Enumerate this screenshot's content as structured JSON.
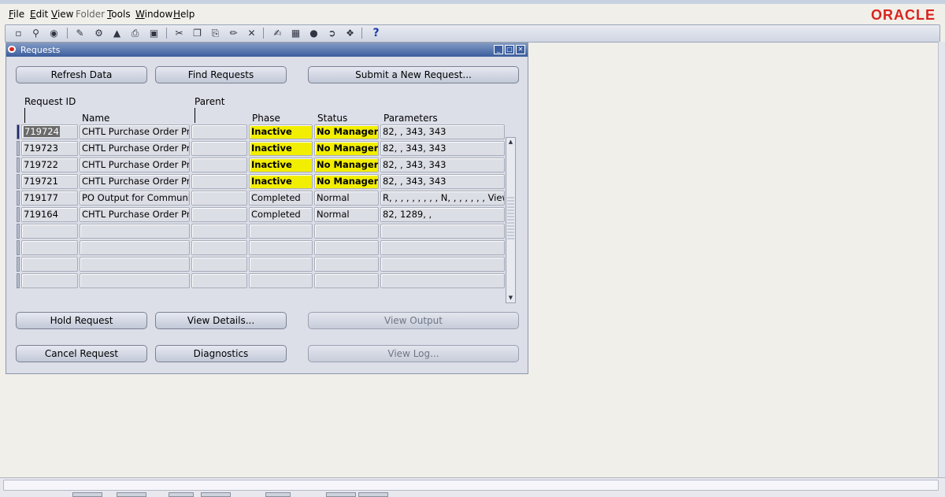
{
  "menu": {
    "items": [
      {
        "label": "File",
        "underline": "F",
        "rest": "ile",
        "disabled": false
      },
      {
        "label": "Edit",
        "underline": "E",
        "rest": "dit",
        "disabled": false
      },
      {
        "label": "View",
        "underline": "V",
        "rest": "iew",
        "disabled": false
      },
      {
        "label": "Folder",
        "underline": "",
        "rest": "Folder",
        "disabled": true
      },
      {
        "label": "Tools",
        "underline": "T",
        "rest": "ools",
        "disabled": false
      },
      {
        "label": "Window",
        "underline": "W",
        "rest": "indow",
        "disabled": false
      },
      {
        "label": "Help",
        "underline": "H",
        "rest": "elp",
        "disabled": false
      }
    ],
    "logo": "ORACLE"
  },
  "toolbar": {
    "icons": [
      "new-icon",
      "find-icon",
      "navigator-icon",
      "save-icon",
      "next-step-icon",
      "switch-responsibility-icon",
      "print-icon",
      "close-form-icon",
      "cut-icon",
      "copy-icon",
      "paste-icon",
      "clear-record-icon",
      "delete-record-icon",
      "edit-field-icon",
      "zoom-icon",
      "translations-icon",
      "attachments-icon",
      "folder-tools-icon",
      "window-help-icon"
    ],
    "help_glyph": "?"
  },
  "window": {
    "title": "Requests",
    "buttons": {
      "refresh": "Refresh Data",
      "find": "Find Requests",
      "submit": "Submit a New Request...",
      "hold": "Hold Request",
      "view_details": "View Details...",
      "view_output": "View Output",
      "cancel": "Cancel Request",
      "diagnostics": "Diagnostics",
      "view_log": "View Log..."
    },
    "columns": {
      "request_id": "Request ID",
      "name": "Name",
      "parent": "Parent",
      "phase": "Phase",
      "status": "Status",
      "parameters": "Parameters"
    },
    "rows": [
      {
        "id": "719724",
        "name": "CHTL Purchase Order Print",
        "parent": "",
        "phase": "Inactive",
        "status": "No Manager",
        "params": "82, , 343, 343",
        "highlight": true
      },
      {
        "id": "719723",
        "name": "CHTL Purchase Order Print",
        "parent": "",
        "phase": "Inactive",
        "status": "No Manager",
        "params": "82, , 343, 343",
        "highlight": true
      },
      {
        "id": "719722",
        "name": "CHTL Purchase Order Print",
        "parent": "",
        "phase": "Inactive",
        "status": "No Manager",
        "params": "82, , 343, 343",
        "highlight": true
      },
      {
        "id": "719721",
        "name": "CHTL Purchase Order Print",
        "parent": "",
        "phase": "Inactive",
        "status": "No Manager",
        "params": "82, , 343, 343",
        "highlight": true
      },
      {
        "id": "719177",
        "name": "PO Output for Communication",
        "parent": "",
        "phase": "Completed",
        "status": "Normal",
        "params": "R, , , , , , , , , N, , , , , , , View,",
        "highlight": false
      },
      {
        "id": "719164",
        "name": "CHTL Purchase Order Print",
        "parent": "",
        "phase": "Completed",
        "status": "Normal",
        "params": "82, 1289, ,",
        "highlight": false
      },
      {
        "id": "",
        "name": "",
        "parent": "",
        "phase": "",
        "status": "",
        "params": "",
        "highlight": false
      },
      {
        "id": "",
        "name": "",
        "parent": "",
        "phase": "",
        "status": "",
        "params": "",
        "highlight": false
      },
      {
        "id": "",
        "name": "",
        "parent": "",
        "phase": "",
        "status": "",
        "params": "",
        "highlight": false
      },
      {
        "id": "",
        "name": "",
        "parent": "",
        "phase": "",
        "status": "",
        "params": "",
        "highlight": false
      }
    ]
  },
  "colors": {
    "accent": "#3b5d9c",
    "highlight": "#f2ee00",
    "logo": "#d9231c"
  }
}
